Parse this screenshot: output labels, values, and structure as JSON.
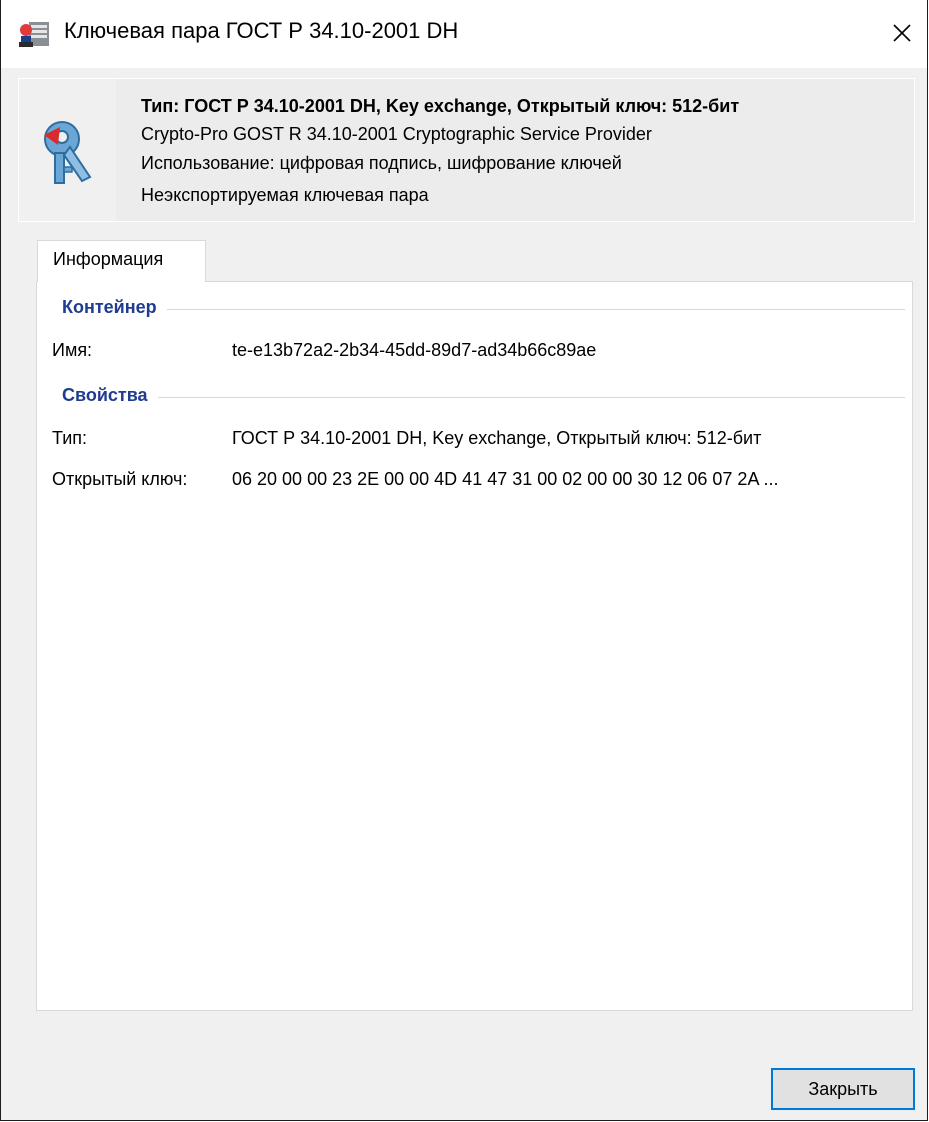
{
  "window": {
    "title": "Ключевая пара ГОСТ Р 34.10-2001 DH",
    "icon": "certificate-keys-icon",
    "close_icon": "close-icon"
  },
  "summary": {
    "icon": "key-pair-icon",
    "line1": "Тип: ГОСТ Р 34.10-2001 DH, Key exchange, Открытый ключ: 512-бит",
    "line2": "Crypto-Pro GOST R 34.10-2001 Cryptographic Service Provider",
    "line3": "Использование: цифровая подпись, шифрование ключей",
    "line4": "Неэкспортируемая ключевая пара"
  },
  "tabs": [
    {
      "label": "Информация",
      "selected": true
    }
  ],
  "sections": {
    "container": {
      "title": "Контейнер",
      "name_label": "Имя:",
      "name_value": "te-e13b72a2-2b34-45dd-89d7-ad34b66c89ae"
    },
    "properties": {
      "title": "Свойства",
      "type_label": "Тип:",
      "type_value": "ГОСТ Р 34.10-2001 DH, Key exchange, Открытый ключ: 512-бит",
      "pubkey_label": "Открытый ключ:",
      "pubkey_value": "06 20 00 00 23 2E 00 00 4D 41 47 31 00 02 00 00 30 12 06 07 2A ..."
    }
  },
  "footer": {
    "close_label": "Закрыть"
  },
  "colors": {
    "section_heading": "#1f3c8f",
    "focus_border": "#0078d7",
    "dialog_bg": "#f0f0f0"
  }
}
